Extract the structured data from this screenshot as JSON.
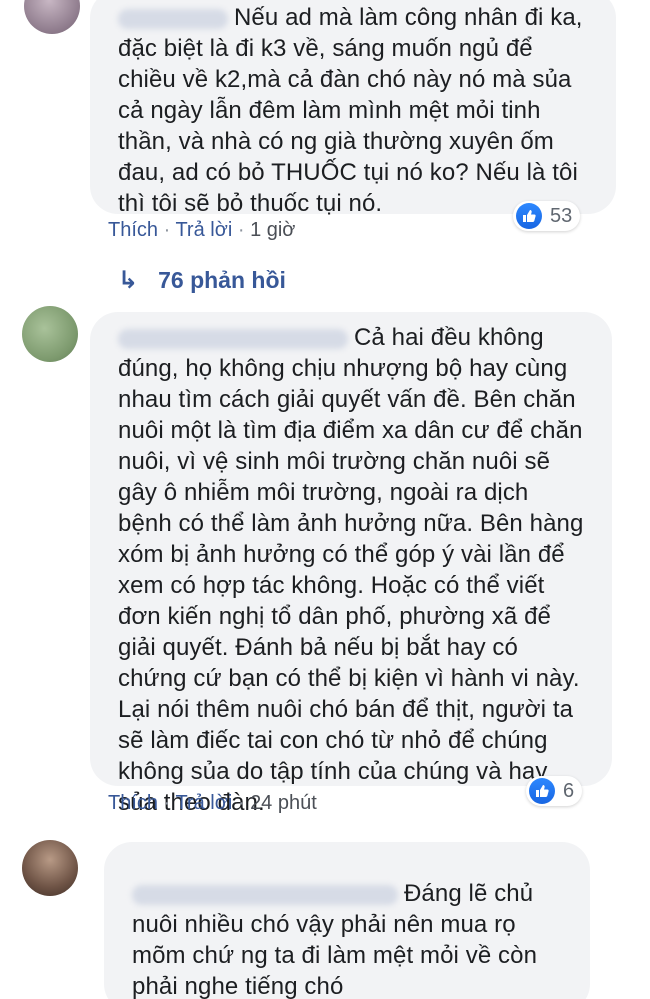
{
  "comments": [
    {
      "text": "Nếu ad mà làm công nhân đi ka, đặc biệt là đi k3 về, sáng muốn ngủ để chiều về k2,mà cả đàn chó này nó mà sủa cả ngày lẫn đêm làm mình mệt mỏi tinh thần, và nhà có ng già thường xuyên ốm đau, ad có bỏ THUỐC tụi nó ko? Nếu là tôi thì tôi sẽ bỏ thuốc tụi nó.",
      "like_label": "Thích",
      "reply_label": "Trả lời",
      "time": "1 giờ",
      "reaction_count": "53"
    },
    {
      "text": "Cả hai đều không đúng, họ không chịu nhượng bộ hay cùng nhau tìm cách giải quyết vấn đề. Bên chăn nuôi một là tìm địa điểm xa dân cư để chăn nuôi, vì vệ sinh môi trường chăn nuôi sẽ gây ô nhiễm môi trường, ngoài ra dịch bệnh có thể làm ảnh hưởng nữa. Bên hàng xóm bị ảnh hưởng có thể góp ý vài lần để xem có hợp tác không. Hoặc có thể viết đơn kiến nghị tổ dân phố, phường xã để giải quyết. Đánh bả nếu bị bắt hay có chứng cứ bạn có thể bị kiện vì hành vi này. Lại nói thêm nuôi chó bán để thịt, người ta sẽ làm điếc tai con chó từ nhỏ để chúng không sủa do tập tính của chúng và hay sủa theo đàn.",
      "like_label": "Thích",
      "reply_label": "Trả lời",
      "time": "24 phút",
      "reaction_count": "6"
    },
    {
      "text": "Đáng lẽ chủ nuôi nhiều chó vậy phải nên mua rọ mõm chứ ng ta đi làm mệt mỏi về còn phải nghe tiếng chó"
    }
  ],
  "replies_label": "76 phản hồi",
  "colors": {
    "link": "#385898",
    "bubble": "#f2f3f5",
    "like": "#1877f2"
  }
}
